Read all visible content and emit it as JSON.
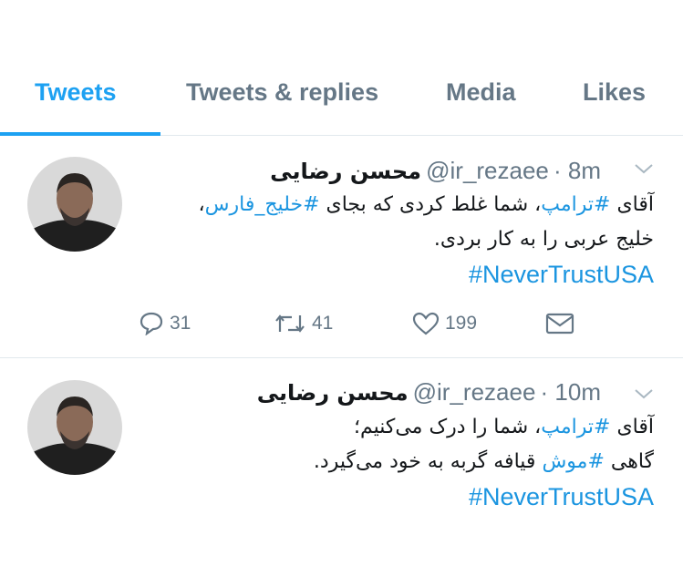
{
  "tabs": [
    {
      "label": "Tweets",
      "active": true
    },
    {
      "label": "Tweets & replies",
      "active": false
    },
    {
      "label": "Media",
      "active": false
    },
    {
      "label": "Likes",
      "active": false
    }
  ],
  "tweets": [
    {
      "name": "محسن رضایی",
      "handle": "@ir_rezaee",
      "time": "· 8m",
      "line1_prefix": "آقای ",
      "line1_tag1": "#ترامپ",
      "line1_mid": "، شما غلط کردی که بجای ",
      "line1_tag2": "#خلیج_فارس",
      "line1_suffix": "،",
      "line2": "خلیج عربی را به کار بردی.",
      "hashtag": "#NeverTrustUSA",
      "replies": "31",
      "retweets": "41",
      "likes": "199"
    },
    {
      "name": "محسن رضایی",
      "handle": "@ir_rezaee",
      "time": "· 10m",
      "line1_prefix": "آقای ",
      "line1_tag1": "#ترامپ",
      "line1_suffix": "، شما را درک می‌کنیم؛",
      "line2_prefix": "گاهی ",
      "line2_tag": "#موش",
      "line2_suffix": " قیافه گربه به خود می‌گیرد.",
      "hashtag": "#NeverTrustUSA"
    }
  ],
  "colors": {
    "accent": "#1da1f2",
    "link": "#1b95e0",
    "muted": "#657786"
  }
}
